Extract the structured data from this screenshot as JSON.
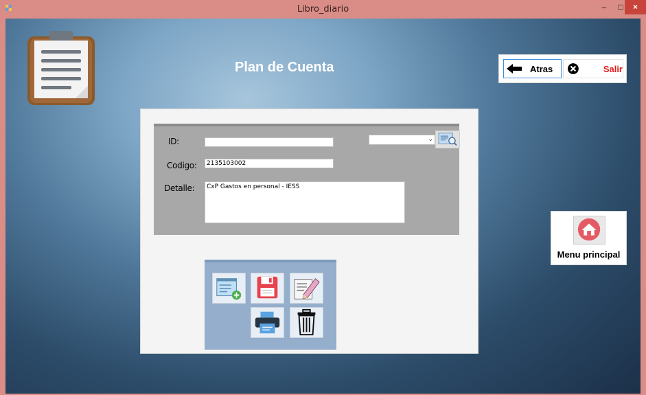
{
  "window": {
    "title": "Libro_diario",
    "minimize": "–",
    "maximize": "□",
    "close": "×"
  },
  "form": {
    "title": "Plan de Cuenta"
  },
  "nav": {
    "back_label": "Atras",
    "exit_label": "Salir"
  },
  "menu": {
    "main_menu_label": "Menu principal"
  },
  "fields": {
    "id_label": "ID:",
    "id_value": "",
    "codigo_label": "Codigo:",
    "codigo_value": "2135103002",
    "detalle_label": "Detalle:",
    "detalle_value": "CxP Gastos en personal - IESS",
    "combo_value": ""
  },
  "icons": {
    "app": "app-icon",
    "clipboard": "clipboard-icon",
    "back": "arrow-left-icon",
    "exit": "close-circle-icon",
    "home": "home-icon",
    "search": "search-document-icon",
    "new": "new-document-icon",
    "save": "floppy-disk-icon",
    "edit": "edit-pencil-icon",
    "print": "printer-icon",
    "delete": "trash-icon"
  },
  "colors": {
    "titlebar": "#d98d86",
    "close_button": "#c8443b",
    "exit_text": "#e21a1a",
    "panel_group": "#a8a8a8",
    "action_group": "#94aecb"
  }
}
